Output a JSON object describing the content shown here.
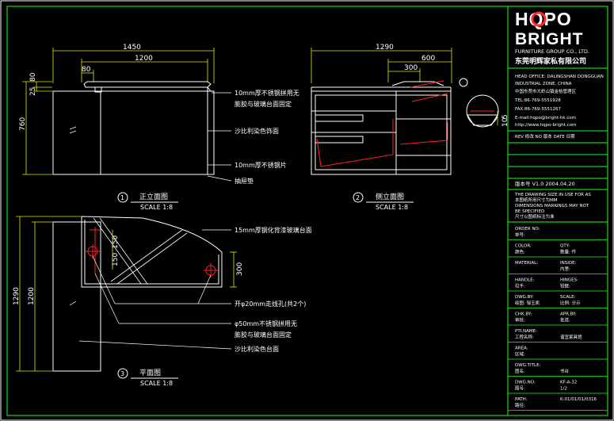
{
  "colors": {
    "background": "#000000",
    "line": "#ffffff",
    "accent_red": "#ff2020",
    "dim_yellow": "#e6e600",
    "border_green": "#1aff1a",
    "brand_red": "#ff2a2a"
  },
  "front_view": {
    "dims": {
      "total": "1450",
      "top": "1200",
      "small": "80",
      "height": "760",
      "v80": "80",
      "v25": "25"
    },
    "notes": [
      "10mm厚不锈钢拼用无",
      "膨胶与玻璃台面固定",
      "沙比利染色饰面",
      "10mm厚不锈钢片",
      "抽屉垫"
    ],
    "label_num": "1",
    "label": "正立面图",
    "scale": "SCALE 1:8"
  },
  "side_view": {
    "dims": {
      "total": "1290",
      "d600": "600",
      "d300": "300",
      "v10": "10",
      "v5": "5"
    },
    "label_num": "2",
    "label": "侧立面图",
    "scale": "SCALE 1:8"
  },
  "plan_view": {
    "dims": {
      "v1290": "1290",
      "v1200": "1200",
      "d150a": "150",
      "d150b": "150",
      "d300": "300"
    },
    "notes": [
      "15mm厚钢化背漆玻璃台面",
      "开φ20mm走线孔(共2个)",
      "φ50mm不锈钢拼用无",
      "膨胶与玻璃台面固定",
      "沙比利染色台面"
    ],
    "label_num": "3",
    "label": "平面图",
    "scale": "SCALE 1:8"
  },
  "title_block": {
    "brand_line1": "HQPO",
    "brand_line2": "BRIGHT",
    "company_en": "FURNITURE GROUP CO., LTD.",
    "company_cn": "东莞明辉家私有限公司",
    "address": [
      "HEAD OFFICE: DALINGSHAN DONGGUAN",
      "INDUSTRIAL ZONE, CHINA",
      "中国东莞市大岭山镇金桔管理区",
      "TEL:86-769-5551928",
      "FAX:86-769-5551267",
      "E-mail:hqpo@bright-hk.com",
      "http://www.hqpo-bright.com"
    ],
    "rev_header": "REV 修改  NO 版本  DATE 日期",
    "version_row": "版本号 V1.0  2004.04.20",
    "notice": [
      "THE DRAWING SIZE IN USE FOR AS",
      "本图纸所用尺寸为MM",
      "DIMENSIONS MARKINGS MAY NOT",
      "BE SPECIFIED",
      "尺寸以图纸标注为准"
    ],
    "rows": [
      {
        "en": "ORDER NO:",
        "cn": "单号:",
        "k2": "",
        "v2": ""
      },
      {
        "en": "COLOR:",
        "cn": "颜色:",
        "k2": "QTY:",
        "v2": "数量:    件"
      },
      {
        "en": "MATERIAL:",
        "cn": "",
        "k2": "INSIDE:",
        "v2": "内里:"
      },
      {
        "en": "HANDLE:",
        "cn": "拉手:",
        "k2": "HINGES:",
        "v2": "铰链:"
      },
      {
        "en": "DWG.BY:",
        "cn": "绘图: 邹玉凯",
        "k2": "SCALE:",
        "v2": "比例:  分示"
      },
      {
        "en": "CHK.BY:",
        "cn": "审核:",
        "k2": "APR.BY:",
        "v2": "批准:"
      },
      {
        "en": "PTI.NAME:",
        "cn": "工程名称:",
        "k2": "",
        "v2": "谐宜家具馆"
      },
      {
        "en": "AREA:",
        "cn": "区域:",
        "k2": "",
        "v2": ""
      },
      {
        "en": "DWG.TITLE:",
        "cn": "图名:",
        "k2": "",
        "v2": "书台"
      },
      {
        "en": "DWG.NO:",
        "cn": "图号:",
        "k2": "KF-A-32",
        "v2": "1/2"
      },
      {
        "en": "PATH:",
        "cn": "路径:",
        "k2": "K:01/01/01/0316",
        "v2": ""
      }
    ]
  }
}
